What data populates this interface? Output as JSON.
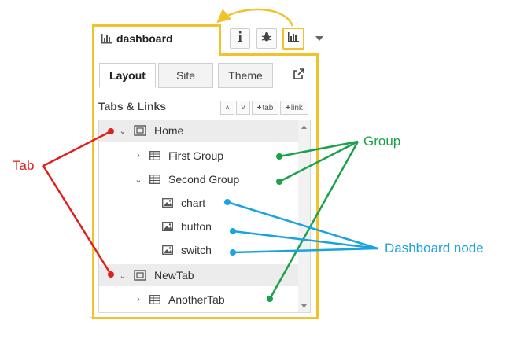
{
  "sidebar_tab": {
    "label": "dashboard",
    "icon": "bar-chart-icon"
  },
  "toolbar": {
    "info_icon": "info-icon",
    "debug_icon": "bug-icon",
    "dashboard_icon": "bar-chart-icon"
  },
  "subtabs": [
    {
      "label": "Layout",
      "active": true
    },
    {
      "label": "Site",
      "active": false
    },
    {
      "label": "Theme",
      "active": false
    }
  ],
  "section": {
    "title": "Tabs & Links",
    "buttons": {
      "up": "˄",
      "down": "˅",
      "add_tab": "tab",
      "add_link": "link"
    }
  },
  "tree": [
    {
      "label": "Home",
      "kind": "tab"
    },
    {
      "label": "First Group",
      "kind": "group"
    },
    {
      "label": "Second Group",
      "kind": "group"
    },
    {
      "label": "chart",
      "kind": "node"
    },
    {
      "label": "button",
      "kind": "node"
    },
    {
      "label": "switch",
      "kind": "node"
    },
    {
      "label": "NewTab",
      "kind": "tab"
    },
    {
      "label": "AnotherTab",
      "kind": "group"
    }
  ],
  "annotations": {
    "tab": "Tab",
    "group": "Group",
    "node": "Dashboard node"
  },
  "colors": {
    "highlight": "#f2c12e",
    "tab": "#e0201c",
    "group": "#1aa24a",
    "node": "#1aa3e0"
  }
}
